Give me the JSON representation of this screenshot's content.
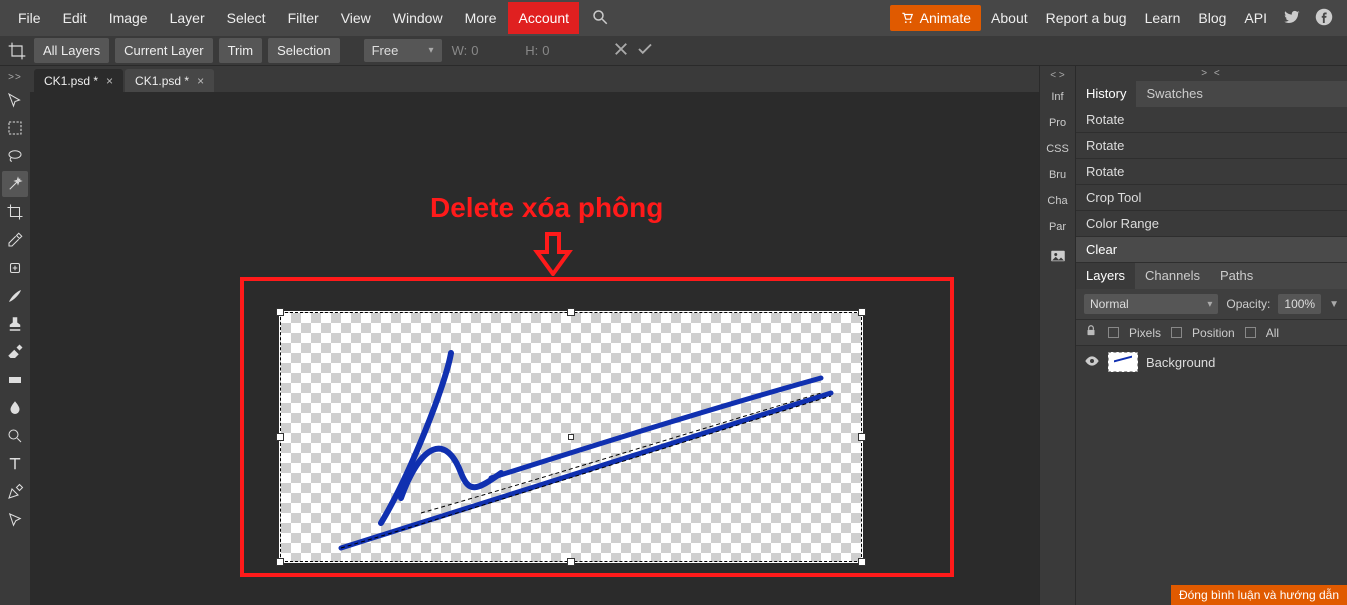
{
  "menubar": {
    "items": [
      "File",
      "Edit",
      "Image",
      "Layer",
      "Select",
      "Filter",
      "View",
      "Window",
      "More"
    ],
    "account": "Account",
    "animate": "Animate",
    "right": [
      "About",
      "Report a bug",
      "Learn",
      "Blog",
      "API"
    ]
  },
  "optbar": {
    "all_layers": "All Layers",
    "current_layer": "Current Layer",
    "trim": "Trim",
    "selection": "Selection",
    "ratio_mode": "Free",
    "w_label": "W:",
    "w_value": "0",
    "h_label": "H:",
    "h_value": "0"
  },
  "tabs": [
    {
      "label": "CK1.psd *",
      "active": true
    },
    {
      "label": "CK1.psd *",
      "active": false
    }
  ],
  "annotation": {
    "title": "Delete xóa phông"
  },
  "right_strip": {
    "items": [
      "Inf",
      "Pro",
      "CSS",
      "Bru",
      "Cha",
      "Par"
    ]
  },
  "panels": {
    "history_swatches": {
      "tabs": [
        "History",
        "Swatches"
      ],
      "active": 0
    },
    "history_items": [
      "Rotate",
      "Rotate",
      "Rotate",
      "Crop Tool",
      "Color Range",
      "Clear"
    ],
    "history_selected_index": 5,
    "lcp": {
      "tabs": [
        "Layers",
        "Channels",
        "Paths"
      ],
      "active": 0
    },
    "layer_opts": {
      "blend": "Normal",
      "opacity_label": "Opacity:",
      "opacity_value": "100%"
    },
    "locks": {
      "pixels": "Pixels",
      "position": "Position",
      "all": "All"
    },
    "layer_name": "Background"
  },
  "bottom_note": "Đóng bình luận và hướng dẫn"
}
